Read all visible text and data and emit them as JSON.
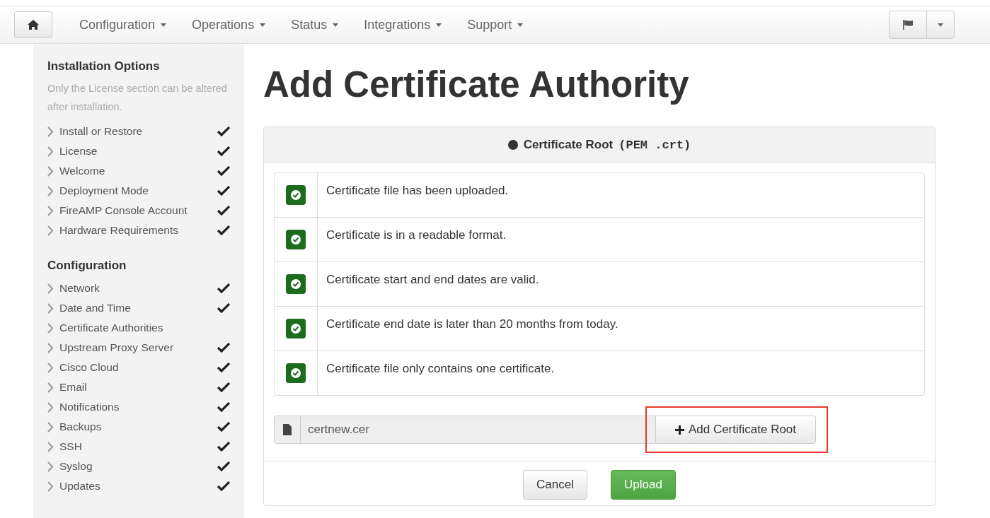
{
  "navbar": {
    "menus": [
      {
        "label": "Configuration"
      },
      {
        "label": "Operations"
      },
      {
        "label": "Status"
      },
      {
        "label": "Integrations"
      },
      {
        "label": "Support"
      }
    ]
  },
  "sidebar": {
    "sections": [
      {
        "title": "Installation Options",
        "note": "Only the License section can be altered after installation.",
        "items": [
          {
            "label": "Install or Restore",
            "checked": true
          },
          {
            "label": "License",
            "checked": true
          },
          {
            "label": "Welcome",
            "checked": true
          },
          {
            "label": "Deployment Mode",
            "checked": true
          },
          {
            "label": "FireAMP Console Account",
            "checked": true
          },
          {
            "label": "Hardware Requirements",
            "checked": true
          }
        ]
      },
      {
        "title": "Configuration",
        "items": [
          {
            "label": "Network",
            "checked": true
          },
          {
            "label": "Date and Time",
            "checked": true
          },
          {
            "label": "Certificate Authorities",
            "checked": false
          },
          {
            "label": "Upstream Proxy Server",
            "checked": true
          },
          {
            "label": "Cisco Cloud",
            "checked": true
          },
          {
            "label": "Email",
            "checked": true
          },
          {
            "label": "Notifications",
            "checked": true
          },
          {
            "label": "Backups",
            "checked": true
          },
          {
            "label": "SSH",
            "checked": true
          },
          {
            "label": "Syslog",
            "checked": true
          },
          {
            "label": "Updates",
            "checked": true
          }
        ]
      }
    ]
  },
  "page_title": "Add Certificate Authority",
  "panel": {
    "title": "Certificate Root",
    "format": "(PEM .crt)",
    "checks": [
      {
        "text": "Certificate file has been uploaded.",
        "passed": true
      },
      {
        "text": "Certificate is in a readable format.",
        "passed": true
      },
      {
        "text": "Certificate start and end dates are valid.",
        "passed": true
      },
      {
        "text": "Certificate end date is later than 20 months from today.",
        "passed": true
      },
      {
        "text": "Certificate file only contains one certificate.",
        "passed": true
      }
    ],
    "file": {
      "value": "certnew.cer"
    },
    "add_button": "Add Certificate Root",
    "buttons": [
      {
        "label": "Cancel",
        "kind": "default"
      },
      {
        "label": "Upload",
        "kind": "primary"
      }
    ]
  }
}
